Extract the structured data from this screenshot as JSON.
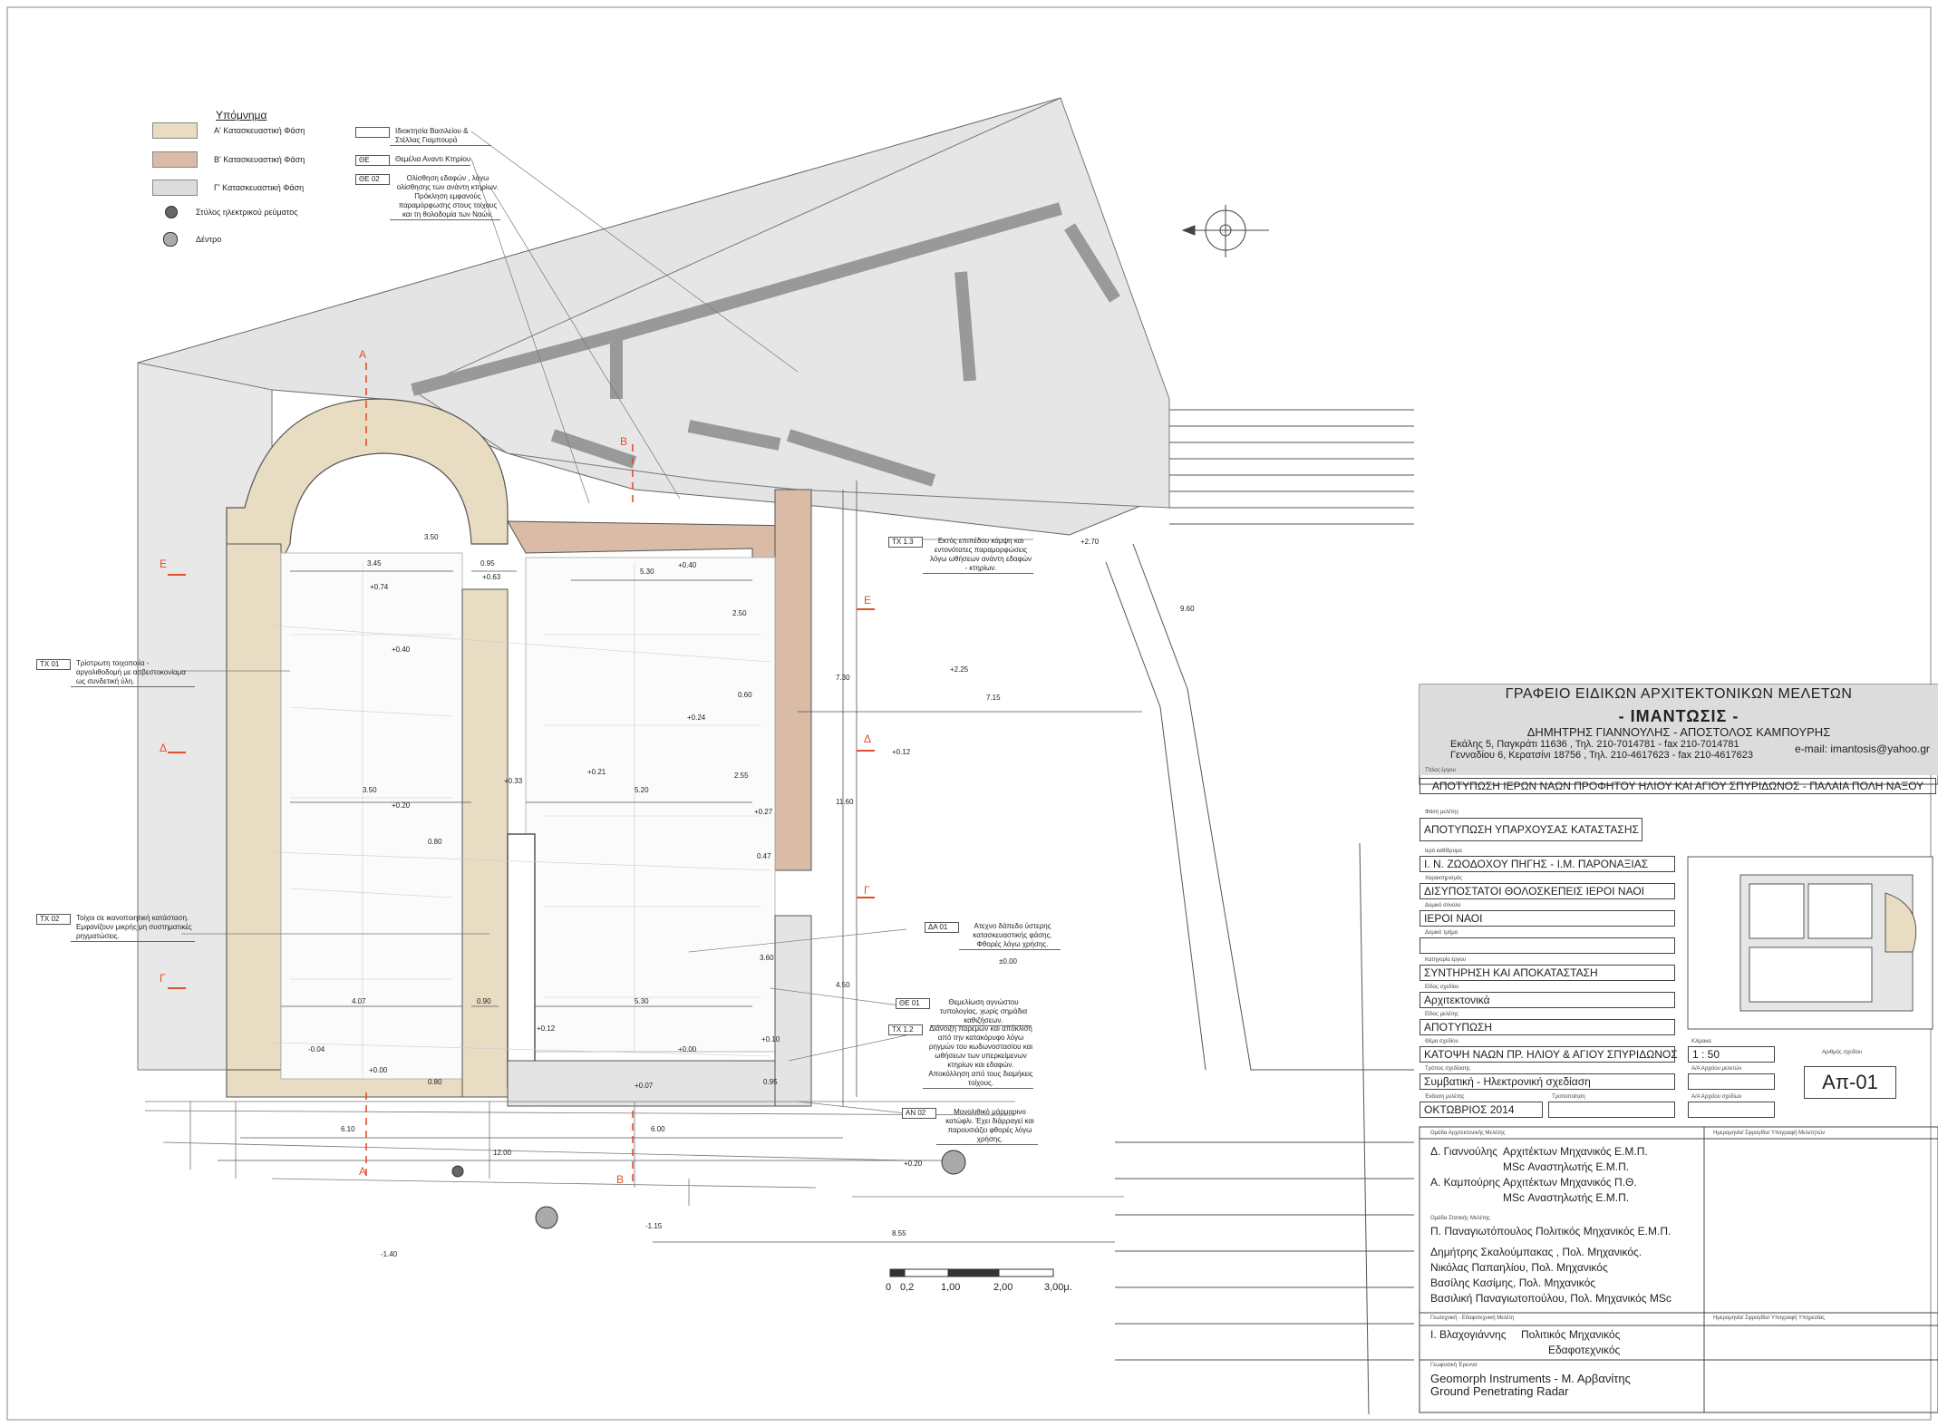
{
  "legend": {
    "title": "Υπόμνημα",
    "items": [
      {
        "label": "Α' Κατασκευαστική Φάση",
        "color": "#e8dcc2"
      },
      {
        "label": "Β' Κατασκευαστική Φάση",
        "color": "#d9bba6"
      },
      {
        "label": "Γ' Κατασκευαστική Φάση",
        "color": "#dcdcdc"
      },
      {
        "label": "Στύλος ηλεκτρικού ρεύματος"
      },
      {
        "label": "Δέντρο"
      }
    ]
  },
  "top_notes": [
    {
      "code": "",
      "text": "Ιδιοκτησία Βασιλείου & Στέλλας Γιαμπουρά"
    },
    {
      "code": "ΘΕ",
      "text": "Θεμέλια Αναντι Κτηρίου"
    },
    {
      "code": "ΘΕ 02",
      "text": "Ολίσθηση εδαφών , λόγω ολίσθησης των ανάντη κτηρίων. Πρόκληση εμφανούς παραμόρφωσης στους τοίχους και τη θολοδομία των Ναών."
    }
  ],
  "left_notes": [
    {
      "code": "ΤΧ 01",
      "text": "Τρίστρωτη τοιχοποιία - αργολιθοδομή με ασβεστοκονίαμα ως συνδετική ύλη."
    },
    {
      "code": "ΤΧ 02",
      "text": "Τοίχοι σε ικανοποιητική κατάσταση. Εμφανίζουν μικρής μη συστηματικές ρηγματώσεις."
    }
  ],
  "right_notes": [
    {
      "code": "ΤΧ 1.3",
      "text": "Εκτός επιπέδου κάμψη και εντονότατες παραμορφώσεις λόγω ωθήσεων ανάντη εδαφών - κτηρίων."
    },
    {
      "code": "ΔΑ 01",
      "text": "Ατεχνο δάπεδο ύστερης κατασκευαστικής φάσης. Φθορές λόγω χρήσης."
    },
    {
      "code": "ΘΕ 01",
      "text": "Θεμελίωση αγνώστου τυπολογίας, χωρίς σημάδια καθιζήσεων."
    },
    {
      "code": "ΤΧ 1.2",
      "text": "Διάνοιξη παρεμών και απόκλιση από την κατακόρυφο λόγω ρηγμών του κωδωνοστασίου και ωθήσεων των υπερκείμενων κτηρίων και εδαφών. Αποκόλληση από τους διαμήκεις τοίχους."
    },
    {
      "code": "ΑΝ 02",
      "text": "Μονολιθικό μάρμαρινο κατώφλι. Έχει διάρραγεί και παρουσιάζει φθορές λόγω χρήσης."
    }
  ],
  "sections": [
    "Α",
    "Α",
    "Β",
    "Β",
    "Γ",
    "Γ",
    "Δ",
    "Δ",
    "Ε",
    "Ε"
  ],
  "levels": [
    "+0.74",
    "+0.63",
    "+0.40",
    "+0.40",
    "+0.24",
    "+0.33",
    "+0.21",
    "+0.20",
    "+0.27",
    "+0.12",
    "+0.12",
    "+0.00",
    "+0.00",
    "+0.07",
    "-0.04",
    "+0.10",
    "+0.20",
    "-1.15",
    "-1.40",
    "+2.70",
    "+2.25",
    "±0.00",
    "+0.00"
  ],
  "dimensions": [
    "3.45",
    "0.95",
    "5.30",
    "2.50",
    "3.50",
    "5.20",
    "2.55",
    "7.15",
    "11.60",
    "7.30",
    "4.50",
    "4.07",
    "0.90",
    "5.30",
    "6.10",
    "6.00",
    "12.00",
    "8.55",
    "0.60",
    "0.47",
    "3.60",
    "0.80",
    "0.95",
    "0.80",
    "3.50",
    "9.60"
  ],
  "scale": {
    "ticks": [
      "0",
      "0,2",
      "1,00",
      "2,00",
      "3,00μ."
    ]
  },
  "office": {
    "name": "ΓΡΑΦΕΙΟ ΕΙΔΙΚΩΝ ΑΡΧΙΤΕΚΤΟΝΙΚΩΝ ΜΕΛΕΤΩΝ",
    "brand": "- ΙΜΑΝΤΩΣΙΣ -",
    "partners": "ΔΗΜΗΤΡΗΣ ΓΙΑΝΝΟΥΛΗΣ  -  ΑΠΟΣΤΟΛΟΣ ΚΑΜΠΟΥΡΗΣ",
    "address1": "Εκάλης 5, Παγκράτι 11636 , Τηλ. 210-7014781 - fax 210-7014781",
    "address2": "Γενναδίου 6, Κερατσίνι 18756 , Τηλ. 210-4617623 - fax 210-4617623",
    "email": "e-mail: imantosis@yahoo.gr"
  },
  "fields": {
    "project_label": "Τίτλος έργου",
    "project": "ΑΠΟΤΥΠΩΣΗ ΙΕΡΩΝ ΝΑΩΝ ΠΡΟΦΗΤΟΥ ΗΛΙΟΥ ΚΑΙ ΑΓΙΟΥ ΣΠΥΡΙΔΩΝΟΣ - ΠΑΛΑΙΑ ΠΟΛΗ ΝΑΞΟΥ",
    "phase_label": "Φάση μελέτης",
    "phase": "ΑΠΟΤΥΠΩΣΗ ΥΠΑΡΧΟΥΣΑΣ ΚΑΤΑΣΤΑΣΗΣ",
    "owner_label": "Ιερό καθίδρυμα",
    "owner": "Ι. Ν. ΖΩΟΔΟΧΟΥ ΠΗΓΗΣ - Ι.Μ. ΠΑΡΟΝΑΞΙΑΣ",
    "char_label": "Χαρακτηρισμός",
    "char": "ΔΙΣΥΠΟΣΤΑΤΟΙ ΘΟΛΟΣΚΕΠΕΙΣ ΙΕΡΟΙ ΝΑΟΙ",
    "unit_label": "Δομικό σύνολο",
    "unit": "ΙΕΡΟΙ ΝΑΟΙ",
    "part_label": "Δομικό τμήμα",
    "part": "",
    "cat_label": "Κατηγορία έργου",
    "cat": "ΣΥΝΤΗΡΗΣΗ ΚΑΙ ΑΠΟΚΑΤΑΣΤΑΣΗ",
    "type_label": "Είδος σχεδίου",
    "type": "Αρχιτεκτονικά",
    "study_label": "Είδος μελέτης",
    "study": "ΑΠΟΤΥΠΩΣΗ",
    "subject_label": "Θέμα σχεδίου",
    "subject": "ΚΑΤΟΨΗ ΝΑΩΝ  ΠΡ. ΗΛΙΟΥ & ΑΓΙΟΥ  ΣΠΥΡΙΔΩΝΟΣ",
    "scale_label": "Κλίμακα",
    "scale": "1 : 50",
    "number_label": "Αριθμός σχεδίου",
    "method_label": "Τρόπος σχεδίασης",
    "method": "Συμβατική - Ηλεκτρονική σχεδίαση",
    "aa_label": "Α/Α Αρχείου μελετών",
    "date_label": "Έκδοση μελέτης",
    "date": "ΟΚΤΩΒΡΙΟΣ 2014",
    "rev_label": "Τροποποίηση",
    "aa2_label": "Α/Α Αρχείου σχεδίων",
    "code": "Απ-01"
  },
  "team": {
    "arch_label": "Ομάδα Αρχιτεκτονικής Μελέτης",
    "sign_label": "Ημερομηνία/ Σφραγίδα/ Υπογραφή Μελετητών",
    "arch": [
      {
        "name": "Δ. Γιαννούλης",
        "role": "Αρχιτέκτων Μηχανικός Ε.Μ.Π.",
        "role2": "MSc Αναστηλωτής Ε.Μ.Π."
      },
      {
        "name": "Α. Καμπούρης",
        "role": "Αρχιτέκτων Μηχανικός Π.Θ.",
        "role2": "MSc Αναστηλωτής Ε.Μ.Π."
      }
    ],
    "struct_label": "Ομάδα Στατικής Μελέτης",
    "struct_lead": "Π. Παναγιωτόπουλος   Πολιτικός Μηχανικός Ε.Μ.Π.",
    "struct": [
      "Δημήτρης Σκαλούμπακας , Πολ. Μηχανικός.",
      "Νικόλας Παπαηλίου, Πολ. Μηχανικός",
      "Βασίλης Κασίμης, Πολ. Μηχανικός",
      "Βασιλική Παναγιωτοπούλου, Πολ. Μηχανικός MSc"
    ],
    "geo_label": "Γεωτεχνική - Εδαφοτεχνική Μελέτη",
    "geo_sign_label": "Ημερομηνία/ Σφραγίδα/ Υπογραφή Υπηρεσίας",
    "geo_name": "Ι. Βλαχογιάννης",
    "geo_role": "Πολιτικός Μηχανικός",
    "geo_role2": "Εδαφοτεχνικός",
    "gpr_label": "Γεωφυσική Έρευνα",
    "gpr1": "Geomorph Instruments - Μ. Αρβανίτης",
    "gpr2": "Ground Penetrating Radar"
  }
}
